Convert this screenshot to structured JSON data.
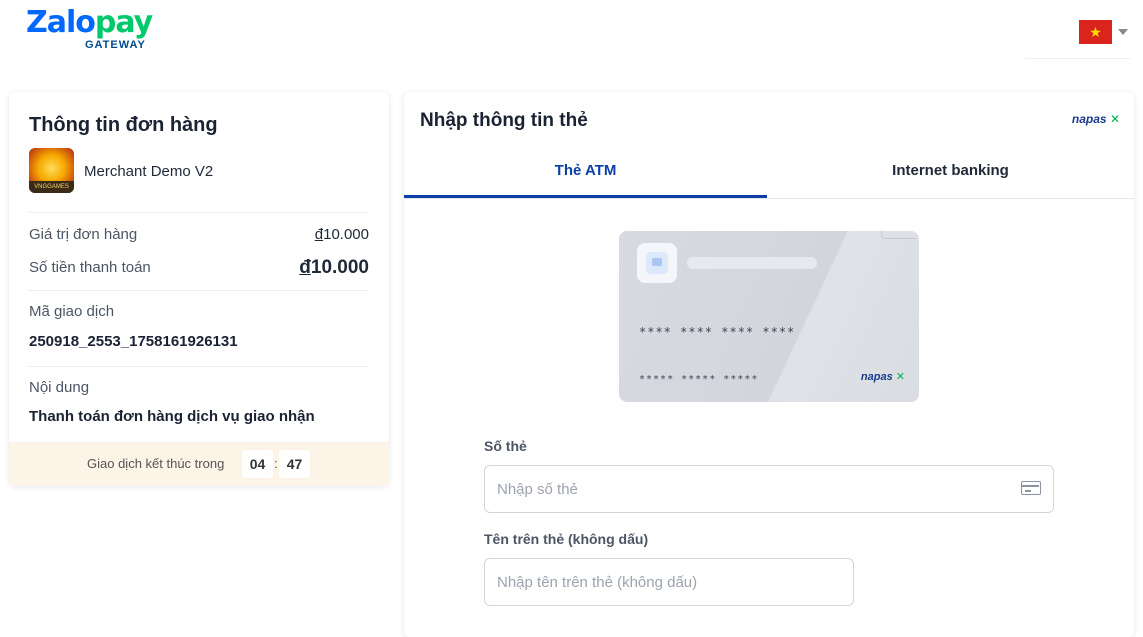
{
  "header": {
    "logo_zalo": "Zalo",
    "logo_pay": "pay",
    "logo_sub": "GATEWAY",
    "language_flag": "vietnam-flag",
    "language_flag_star": "★"
  },
  "order": {
    "title": "Thông tin đơn hàng",
    "merchant_name": "Merchant Demo V2",
    "merchant_logo_text": "VNGGAMES",
    "order_value_label": "Giá trị đơn hàng",
    "order_value_currency": "đ",
    "order_value": "10.000",
    "payment_amount_label": "Số tiền thanh toán",
    "payment_amount_currency": "đ",
    "payment_amount": "10.000",
    "transaction_id_label": "Mã giao dịch",
    "transaction_id": "250918_2553_1758161926131",
    "content_label": "Nội dung",
    "content": "Thanh toán đơn hàng dịch vụ giao nhận",
    "timer_label": "Giao dịch kết thúc trong",
    "timer_minutes": "04",
    "timer_separator": ":",
    "timer_seconds": "47"
  },
  "payment": {
    "title": "Nhập thông tin thẻ",
    "napas_logo_text": "napas",
    "napas_logo_mark": "✕",
    "tabs": [
      {
        "label": "Thẻ ATM",
        "active": true
      },
      {
        "label": "Internet banking",
        "active": false
      }
    ],
    "card_preview": {
      "number_mask": "**** **** **** ****",
      "name_mask": "***** ***** *****",
      "napas_text": "napas",
      "napas_mark": "✕"
    },
    "card_number_label": "Số thẻ",
    "card_number_placeholder": "Nhập số thẻ",
    "card_number_value": "",
    "card_name_label": "Tên trên thẻ (không dấu)",
    "card_name_placeholder": "Nhập tên trên thẻ (không dấu)",
    "card_name_value": ""
  },
  "colors": {
    "brand_blue": "#0068ff",
    "brand_green": "#00c96b",
    "tab_active": "#0b3fa6",
    "timer_bg": "#fdf4e8"
  }
}
